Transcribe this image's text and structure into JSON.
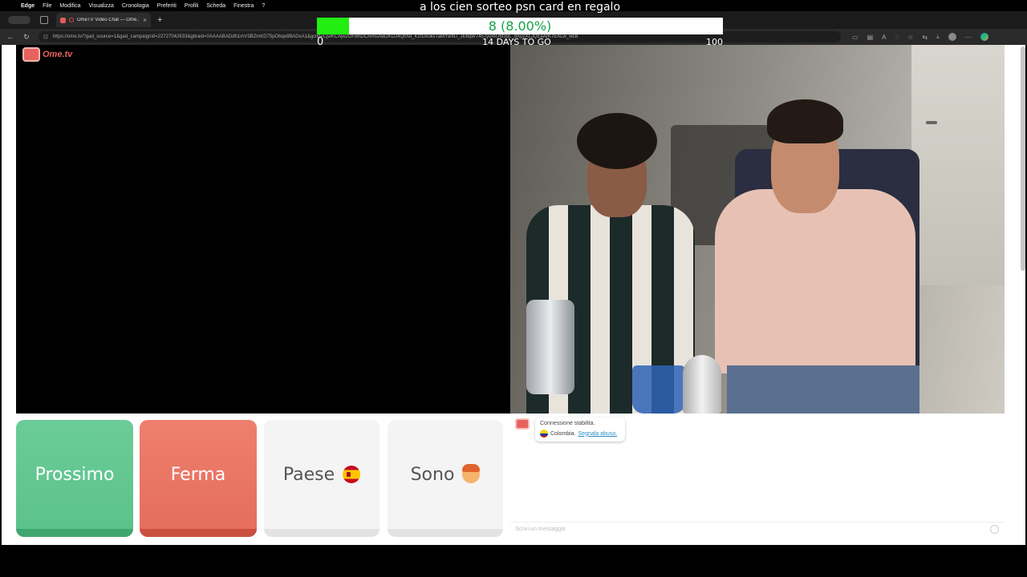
{
  "menubar": {
    "items": [
      "Edge",
      "File",
      "Modifica",
      "Visualizza",
      "Cronologia",
      "Preferiti",
      "Profili",
      "Scheda",
      "Finestra",
      "?"
    ]
  },
  "browser": {
    "tab_title": "OmeTV Video Chat — Ome...",
    "url": "https://ome.tv/?gad_source=1&gad_campaignid=22727042633&gbraid=0AAAABADdh1mV3BZmKD75pObqx8BADxA1&gclid=CjwKCAjw2DFBhDCARIsABDKOJ4Qhhd_Kzf1mokvTaMYwfIU_JE6qW7457yomrJ6f3oL_dXpzXLJQEaArK7EALw_wcB"
  },
  "overlay": {
    "title": "a los cien sorteo psn card en regalo",
    "progress_text": "8 (8.00%)",
    "progress_value": 8,
    "progress_max": 100,
    "min_label": "0",
    "max_label": "100",
    "days_label": "14 DAYS TO GO",
    "bar_color": "#22ee11"
  },
  "ometv": {
    "logo_text": "Ome.tv",
    "buttons": {
      "next": "Prossimo",
      "stop": "Ferma",
      "country": "Paese",
      "gender": "Sono"
    },
    "chat": {
      "status": "Connessione stabilita.",
      "country": "Colombia.",
      "report": "Segnala abuso.",
      "placeholder": "Scrivi un messaggio"
    },
    "colors": {
      "next": "#5cc28b",
      "stop": "#e56e5d",
      "brand": "#e8625d"
    }
  }
}
